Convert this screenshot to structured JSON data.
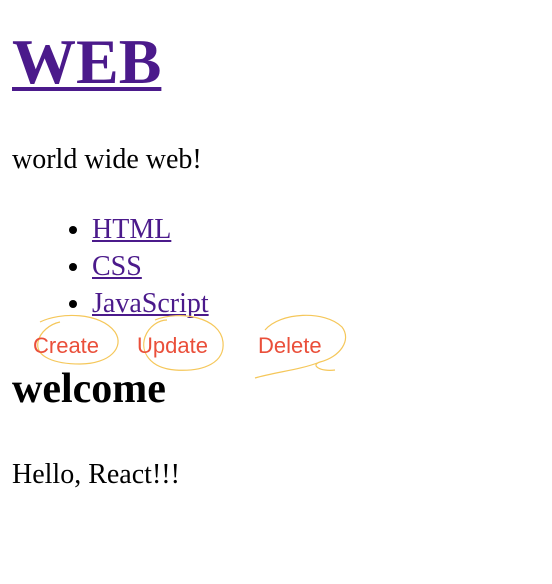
{
  "header": {
    "title": "WEB",
    "tagline": "world wide web!"
  },
  "nav": {
    "items": [
      {
        "label": "HTML"
      },
      {
        "label": "CSS"
      },
      {
        "label": "JavaScript"
      }
    ]
  },
  "actions": {
    "create_label": "Create",
    "update_label": "Update",
    "delete_label": "Delete",
    "link_color": "#ea4f3a",
    "scribble_color": "#f5c75a"
  },
  "article": {
    "heading": "welcome",
    "body": "Hello, React!!!"
  },
  "colors": {
    "link": "#4b1a8b",
    "text": "#000000",
    "background": "#ffffff"
  }
}
